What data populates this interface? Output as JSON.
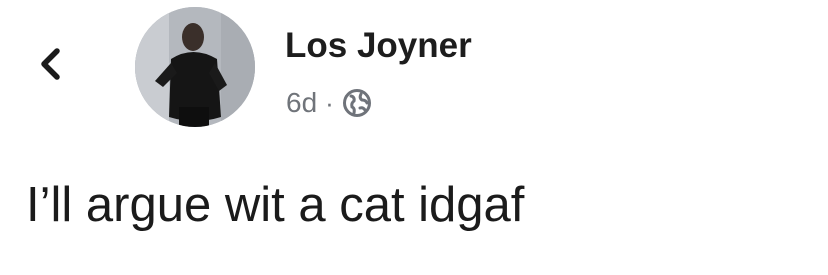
{
  "post": {
    "author_name": "Los Joyner",
    "timestamp": "6d",
    "separator": "·",
    "audience_icon": "globe-icon",
    "text": "I’ll argue wit a cat idgaf"
  },
  "nav": {
    "back_icon": "chevron-left-icon"
  }
}
